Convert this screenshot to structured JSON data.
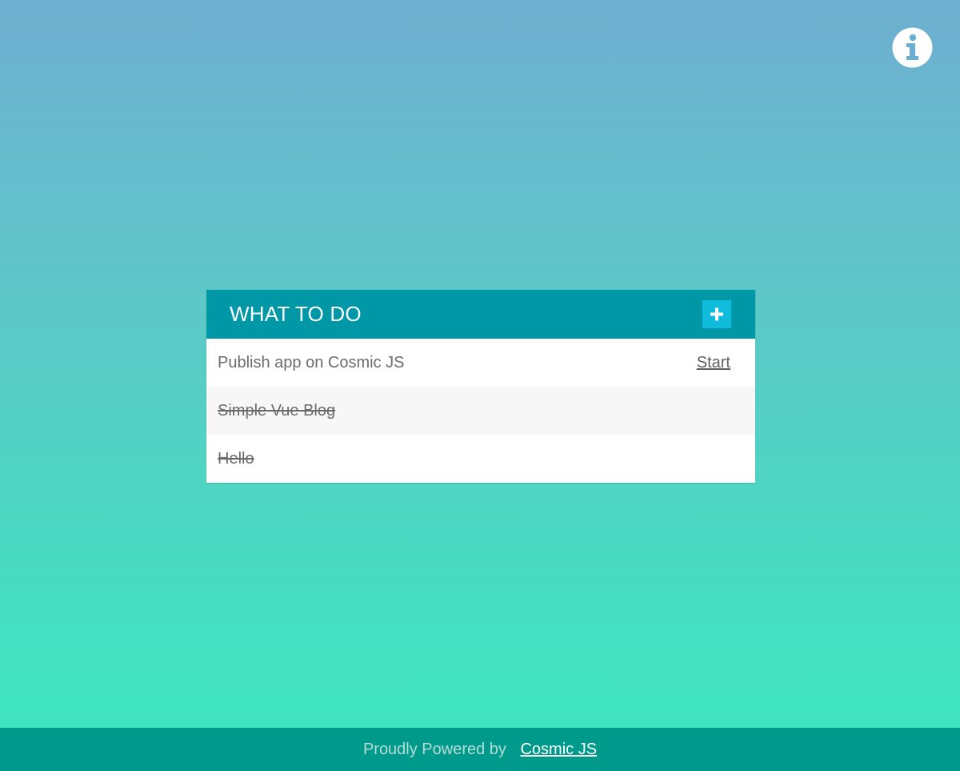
{
  "header": {
    "info_icon": "info-circle-icon"
  },
  "card": {
    "title": "WHAT TO DO",
    "add_icon": "plus-icon",
    "header_color": "#0097a6",
    "add_button_color": "#0fbcdc"
  },
  "todos": [
    {
      "text": "Publish app on Cosmic JS",
      "done": false,
      "action": "Start"
    },
    {
      "text": "Simple Vue Blog",
      "done": true,
      "action": ""
    },
    {
      "text": "Hello",
      "done": true,
      "action": ""
    }
  ],
  "footer": {
    "label": "Proudly Powered by",
    "link_text": "Cosmic JS",
    "background_color": "#009a8c"
  }
}
